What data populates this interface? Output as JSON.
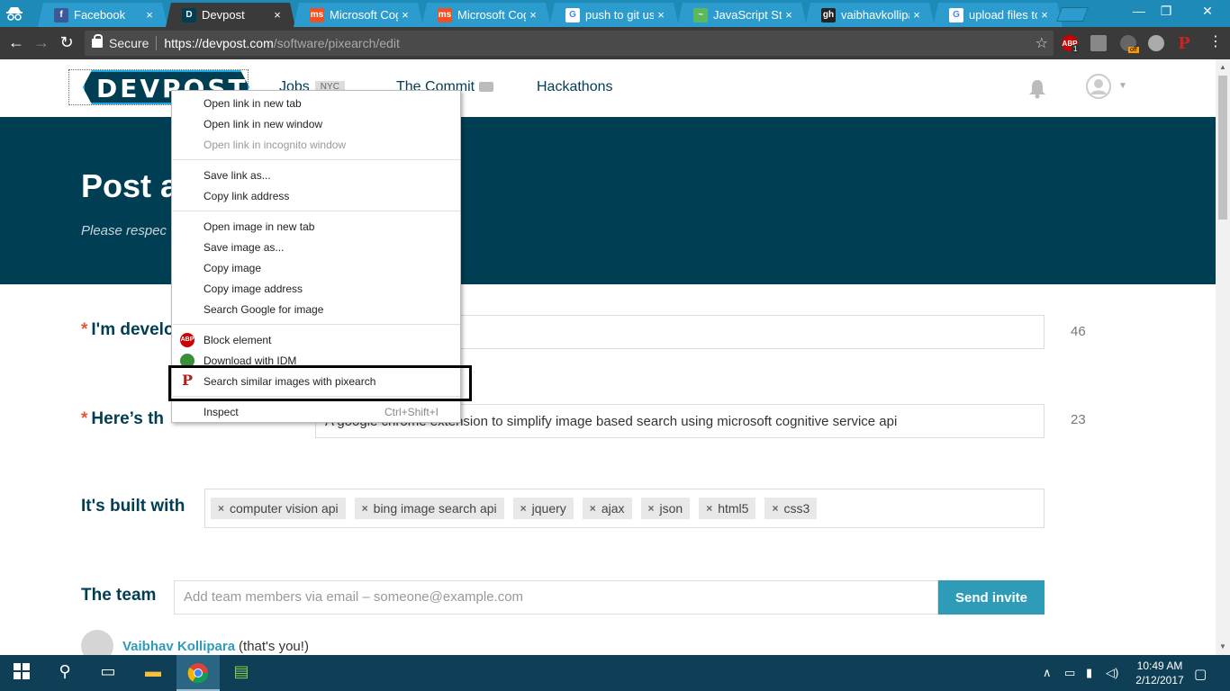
{
  "browser": {
    "tabs": [
      {
        "title": "Facebook",
        "fav": "f",
        "favbg": "#3b5998"
      },
      {
        "title": "Devpost",
        "fav": "D",
        "favbg": "#003e54",
        "active": true
      },
      {
        "title": "Microsoft Cogn",
        "fav": "ms",
        "favbg": "#f25022"
      },
      {
        "title": "Microsoft Cogn",
        "fav": "ms",
        "favbg": "#f25022"
      },
      {
        "title": "push to git usin",
        "fav": "G",
        "favbg": "#ffffff"
      },
      {
        "title": "JavaScript Strin",
        "fav": "~",
        "favbg": "#5cb85c"
      },
      {
        "title": "vaibhavkollipar",
        "fav": "gh",
        "favbg": "#222222"
      },
      {
        "title": "upload files to",
        "fav": "G",
        "favbg": "#ffffff"
      }
    ],
    "tab_close": "×",
    "secure_label": "Secure",
    "url_host": "https://devpost.com",
    "url_path": "/software/pixearch/edit",
    "ext_abp": "ABP",
    "ext_abp_count": "1",
    "ext_off": "off",
    "ext_p": "P"
  },
  "site": {
    "logo": "DEVPOST",
    "nav": {
      "jobs": "Jobs",
      "jobs_badge": "NYC",
      "commit": "The Commit",
      "hackathons": "Hackathons"
    }
  },
  "hero": {
    "title": "Post a",
    "subtitle": "Please respec"
  },
  "form": {
    "developing_label": "I'm develo",
    "developing_count": "46",
    "elevator_label": "Here’s th",
    "elevator_value": "A google chrome extension to simplify image based search using microsoft cognitive service api",
    "elevator_count": "23",
    "built_label": "It's built with",
    "tags": [
      "computer vision api",
      "bing image search api",
      "jquery",
      "ajax",
      "json",
      "html5",
      "css3"
    ],
    "team_label": "The team",
    "invite_placeholder": "Add team members via email – someone@example.com",
    "invite_button": "Send invite",
    "member_name": "Vaibhav Kollipara",
    "member_note": "(that's you!)"
  },
  "context_menu": {
    "open_new_tab": "Open link in new tab",
    "open_new_window": "Open link in new window",
    "open_incognito": "Open link in incognito window",
    "save_link": "Save link as...",
    "copy_link": "Copy link address",
    "open_image": "Open image in new tab",
    "save_image": "Save image as...",
    "copy_image": "Copy image",
    "copy_image_address": "Copy image address",
    "search_google": "Search Google for image",
    "block_element": "Block element",
    "download_idm": "Download with IDM",
    "search_pixearch": "Search similar images with pixearch",
    "inspect": "Inspect",
    "inspect_shortcut": "Ctrl+Shift+I"
  },
  "taskbar": {
    "time": "10:49 AM",
    "date": "2/12/2017"
  },
  "colors": {
    "brand": "#003e54",
    "accent": "#2e9bb8",
    "chrome_tab": "#1e8ab8"
  }
}
